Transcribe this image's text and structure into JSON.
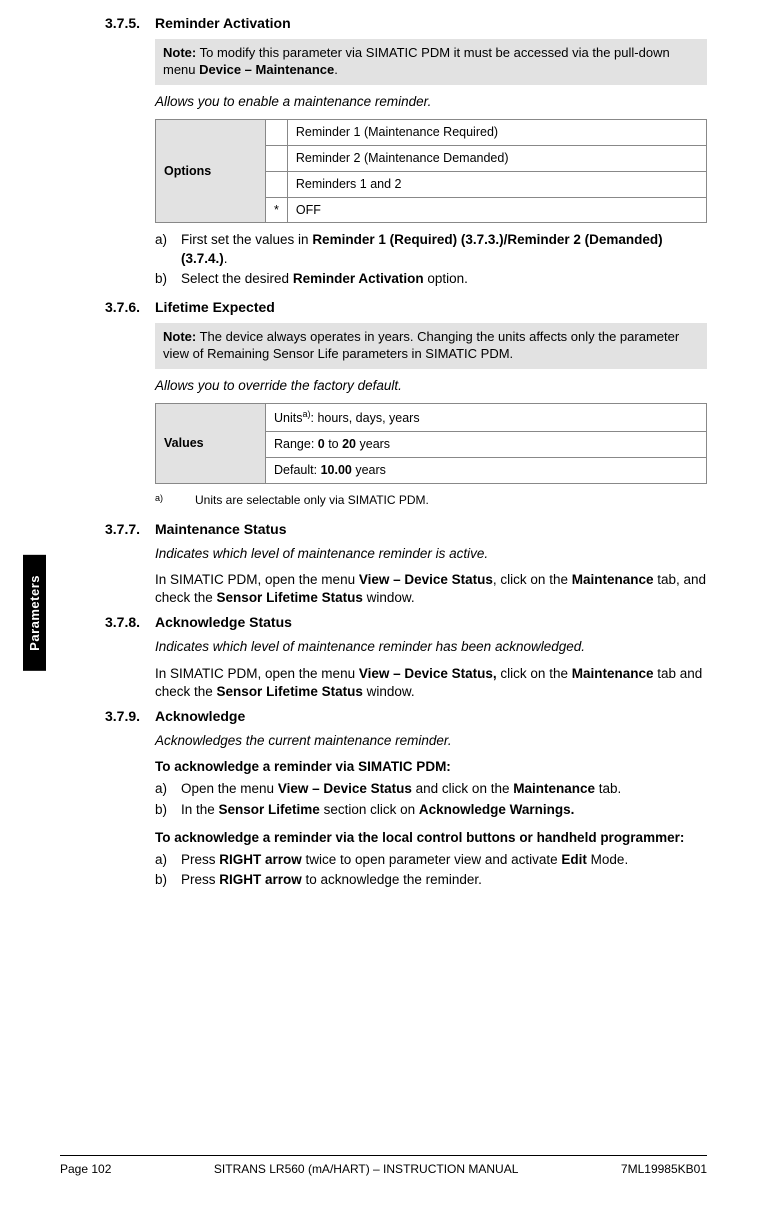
{
  "side_tab": "Parameters",
  "s375": {
    "num": "3.7.5.",
    "title": "Reminder Activation",
    "note_prefix": "Note:",
    "note_text": " To modify this parameter via SIMATIC PDM it must be accessed via the pull-down menu ",
    "note_bold": "Device – Maintenance",
    "note_suffix": ".",
    "desc": "Allows you to enable a maintenance reminder.",
    "table": {
      "label": "Options",
      "rows": [
        "Reminder 1 (Maintenance Required)",
        "Reminder 2 (Maintenance Demanded)",
        "Reminders 1 and 2"
      ],
      "default_star": "*",
      "default_val": "OFF"
    },
    "list": {
      "a": {
        "m": "a)",
        "pre": "First set the values in ",
        "b": "Reminder 1 (Required) (3.7.3.)/Reminder 2 (Demanded) (3.7.4.)",
        "post": "."
      },
      "b": {
        "m": "b)",
        "pre": "Select the desired ",
        "b": "Reminder Activation",
        "post": " option."
      }
    }
  },
  "s376": {
    "num": "3.7.6.",
    "title": "Lifetime Expected",
    "note_prefix": "Note:",
    "note_text": " The device always operates in years. Changing the units affects only the parameter view of Remaining Sensor Life parameters in SIMATIC PDM.",
    "desc": "Allows you to override the factory default.",
    "table": {
      "label": "Values",
      "units_pre": "Units",
      "units_sup": "a)",
      "units_post": ": hours, days, years",
      "range_pre": "Range: ",
      "range_b1": "0",
      "range_mid": " to ",
      "range_b2": "20",
      "range_post": " years",
      "def_pre": "Default: ",
      "def_b": "10.00",
      "def_post": " years"
    },
    "footnote": {
      "marker": "a)",
      "text": "Units are selectable only via SIMATIC PDM."
    }
  },
  "s377": {
    "num": "3.7.7.",
    "title": "Maintenance Status",
    "desc": "Indicates which level of maintenance reminder is active.",
    "p_pre": "In SIMATIC PDM, open the menu ",
    "p_b1": "View – Device Status",
    "p_mid1": ", click on the ",
    "p_b2": "Maintenance",
    "p_mid2": " tab, and check the ",
    "p_b3": "Sensor Lifetime Status",
    "p_post": " window."
  },
  "s378": {
    "num": "3.7.8.",
    "title": "Acknowledge Status",
    "desc": "Indicates which level of maintenance reminder has been acknowledged.",
    "p_pre": "In SIMATIC PDM, open the menu ",
    "p_b1": "View – Device Status,",
    "p_mid1": " click on the ",
    "p_b2": "Maintenance",
    "p_mid2": " tab and check the ",
    "p_b3": "Sensor Lifetime Status",
    "p_post": " window."
  },
  "s379": {
    "num": "3.7.9.",
    "title": "Acknowledge",
    "desc": "Acknowledges the current maintenance reminder.",
    "h1": "To acknowledge a reminder via SIMATIC PDM:",
    "l1a": {
      "m": "a)",
      "pre": "Open the menu ",
      "b1": "View – Device Status",
      "mid": " and click on the ",
      "b2": "Maintenance",
      "post": " tab."
    },
    "l1b": {
      "m": "b)",
      "pre": "In the ",
      "b1": "Sensor Lifetime",
      "mid": " section click on ",
      "b2": "Acknowledge Warnings.",
      "post": ""
    },
    "h2": "To acknowledge a reminder via the local control buttons or handheld programmer:",
    "l2a": {
      "m": "a)",
      "pre": "Press ",
      "b1": "RIGHT arrow",
      "mid": "  twice to open parameter view and activate ",
      "b2": "Edit",
      "post": " Mode."
    },
    "l2b": {
      "m": "b)",
      "pre": "Press ",
      "b1": "RIGHT arrow",
      "mid": "  to acknowledge the reminder.",
      "b2": "",
      "post": ""
    }
  },
  "footer": {
    "left": "Page 102",
    "center": "SITRANS LR560 (mA/HART) – INSTRUCTION MANUAL",
    "right": "7ML19985KB01"
  }
}
